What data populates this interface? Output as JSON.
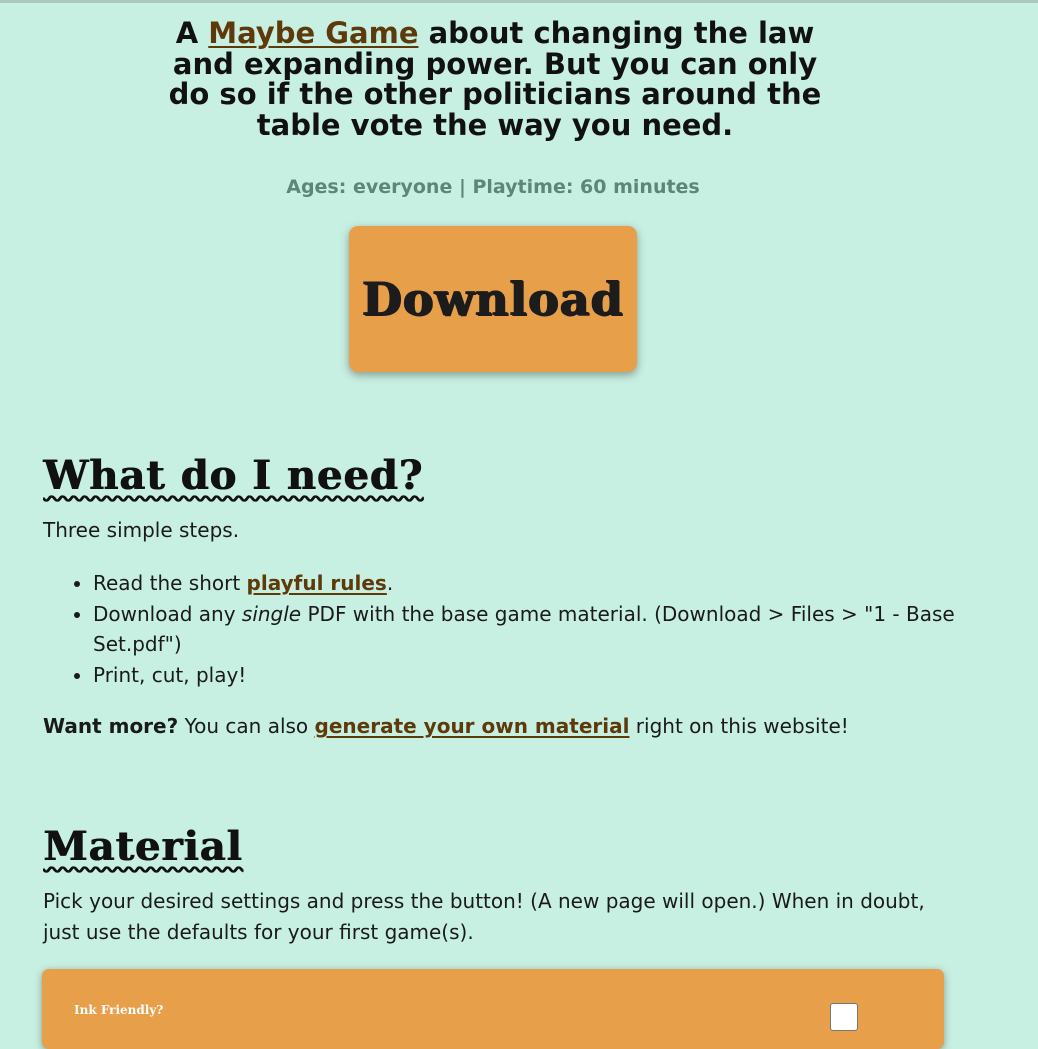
{
  "hero": {
    "prefix": "A ",
    "link": "Maybe Game",
    "rest": " about changing the law and expanding power. But you can only do so if the other politicians around the table vote the way you need."
  },
  "meta": "Ages: everyone | Playtime: 60 minutes",
  "download_button": "Download",
  "need_section": {
    "title": "What do I need?",
    "intro": "Three simple steps.",
    "steps": {
      "s1": {
        "before": "Read the short ",
        "link": "playful rules",
        "after": "."
      },
      "s2": {
        "before": "Download any ",
        "em": "single",
        "after": " PDF with the base game material. (Download > Files > \"1 - Base Set.pdf\")"
      },
      "s3": {
        "text": "Print, cut, play!"
      }
    },
    "more": {
      "strong": "Want more?",
      "before": " You can also ",
      "link": "generate your own material",
      "after": " right on this website!"
    }
  },
  "material_section": {
    "title": "Material",
    "description": "Pick your desired settings and press the button! (A new page will open.) When in doubt, just use the defaults for your first game(s).",
    "first_setting_label": "Ink Friendly?"
  },
  "colors": {
    "background": "#c8f0e2",
    "accent": "#e89f4a",
    "link": "#5e3a0b",
    "muted": "#5d8578"
  }
}
